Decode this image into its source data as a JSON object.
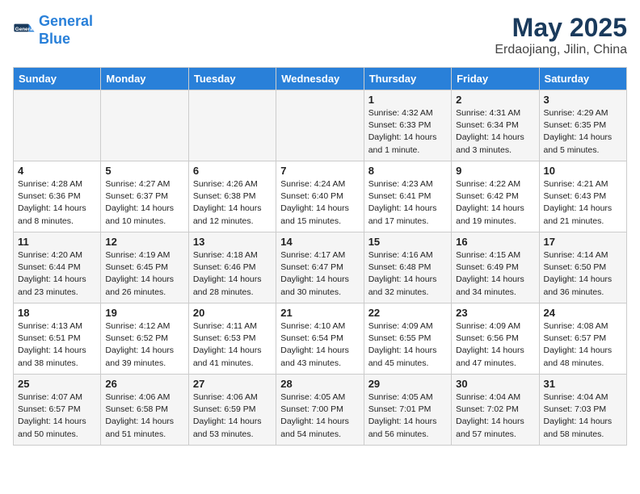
{
  "header": {
    "logo_line1": "General",
    "logo_line2": "Blue",
    "title": "May 2025",
    "subtitle": "Erdaojiang, Jilin, China"
  },
  "weekdays": [
    "Sunday",
    "Monday",
    "Tuesday",
    "Wednesday",
    "Thursday",
    "Friday",
    "Saturday"
  ],
  "weeks": [
    [
      {
        "day": "",
        "info": ""
      },
      {
        "day": "",
        "info": ""
      },
      {
        "day": "",
        "info": ""
      },
      {
        "day": "",
        "info": ""
      },
      {
        "day": "1",
        "info": "Sunrise: 4:32 AM\nSunset: 6:33 PM\nDaylight: 14 hours and 1 minute."
      },
      {
        "day": "2",
        "info": "Sunrise: 4:31 AM\nSunset: 6:34 PM\nDaylight: 14 hours and 3 minutes."
      },
      {
        "day": "3",
        "info": "Sunrise: 4:29 AM\nSunset: 6:35 PM\nDaylight: 14 hours and 5 minutes."
      }
    ],
    [
      {
        "day": "4",
        "info": "Sunrise: 4:28 AM\nSunset: 6:36 PM\nDaylight: 14 hours and 8 minutes."
      },
      {
        "day": "5",
        "info": "Sunrise: 4:27 AM\nSunset: 6:37 PM\nDaylight: 14 hours and 10 minutes."
      },
      {
        "day": "6",
        "info": "Sunrise: 4:26 AM\nSunset: 6:38 PM\nDaylight: 14 hours and 12 minutes."
      },
      {
        "day": "7",
        "info": "Sunrise: 4:24 AM\nSunset: 6:40 PM\nDaylight: 14 hours and 15 minutes."
      },
      {
        "day": "8",
        "info": "Sunrise: 4:23 AM\nSunset: 6:41 PM\nDaylight: 14 hours and 17 minutes."
      },
      {
        "day": "9",
        "info": "Sunrise: 4:22 AM\nSunset: 6:42 PM\nDaylight: 14 hours and 19 minutes."
      },
      {
        "day": "10",
        "info": "Sunrise: 4:21 AM\nSunset: 6:43 PM\nDaylight: 14 hours and 21 minutes."
      }
    ],
    [
      {
        "day": "11",
        "info": "Sunrise: 4:20 AM\nSunset: 6:44 PM\nDaylight: 14 hours and 23 minutes."
      },
      {
        "day": "12",
        "info": "Sunrise: 4:19 AM\nSunset: 6:45 PM\nDaylight: 14 hours and 26 minutes."
      },
      {
        "day": "13",
        "info": "Sunrise: 4:18 AM\nSunset: 6:46 PM\nDaylight: 14 hours and 28 minutes."
      },
      {
        "day": "14",
        "info": "Sunrise: 4:17 AM\nSunset: 6:47 PM\nDaylight: 14 hours and 30 minutes."
      },
      {
        "day": "15",
        "info": "Sunrise: 4:16 AM\nSunset: 6:48 PM\nDaylight: 14 hours and 32 minutes."
      },
      {
        "day": "16",
        "info": "Sunrise: 4:15 AM\nSunset: 6:49 PM\nDaylight: 14 hours and 34 minutes."
      },
      {
        "day": "17",
        "info": "Sunrise: 4:14 AM\nSunset: 6:50 PM\nDaylight: 14 hours and 36 minutes."
      }
    ],
    [
      {
        "day": "18",
        "info": "Sunrise: 4:13 AM\nSunset: 6:51 PM\nDaylight: 14 hours and 38 minutes."
      },
      {
        "day": "19",
        "info": "Sunrise: 4:12 AM\nSunset: 6:52 PM\nDaylight: 14 hours and 39 minutes."
      },
      {
        "day": "20",
        "info": "Sunrise: 4:11 AM\nSunset: 6:53 PM\nDaylight: 14 hours and 41 minutes."
      },
      {
        "day": "21",
        "info": "Sunrise: 4:10 AM\nSunset: 6:54 PM\nDaylight: 14 hours and 43 minutes."
      },
      {
        "day": "22",
        "info": "Sunrise: 4:09 AM\nSunset: 6:55 PM\nDaylight: 14 hours and 45 minutes."
      },
      {
        "day": "23",
        "info": "Sunrise: 4:09 AM\nSunset: 6:56 PM\nDaylight: 14 hours and 47 minutes."
      },
      {
        "day": "24",
        "info": "Sunrise: 4:08 AM\nSunset: 6:57 PM\nDaylight: 14 hours and 48 minutes."
      }
    ],
    [
      {
        "day": "25",
        "info": "Sunrise: 4:07 AM\nSunset: 6:57 PM\nDaylight: 14 hours and 50 minutes."
      },
      {
        "day": "26",
        "info": "Sunrise: 4:06 AM\nSunset: 6:58 PM\nDaylight: 14 hours and 51 minutes."
      },
      {
        "day": "27",
        "info": "Sunrise: 4:06 AM\nSunset: 6:59 PM\nDaylight: 14 hours and 53 minutes."
      },
      {
        "day": "28",
        "info": "Sunrise: 4:05 AM\nSunset: 7:00 PM\nDaylight: 14 hours and 54 minutes."
      },
      {
        "day": "29",
        "info": "Sunrise: 4:05 AM\nSunset: 7:01 PM\nDaylight: 14 hours and 56 minutes."
      },
      {
        "day": "30",
        "info": "Sunrise: 4:04 AM\nSunset: 7:02 PM\nDaylight: 14 hours and 57 minutes."
      },
      {
        "day": "31",
        "info": "Sunrise: 4:04 AM\nSunset: 7:03 PM\nDaylight: 14 hours and 58 minutes."
      }
    ]
  ]
}
